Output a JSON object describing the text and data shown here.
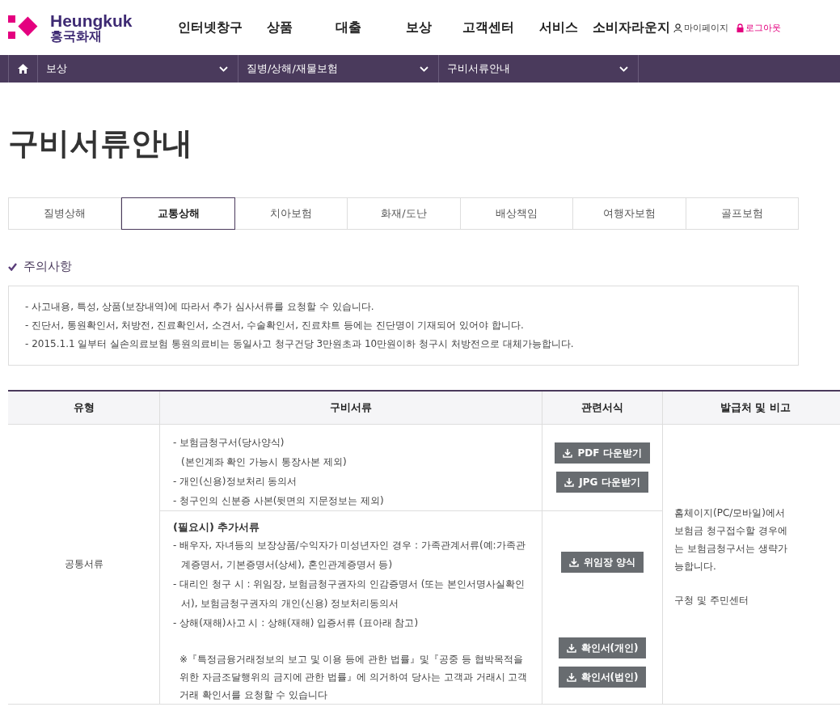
{
  "logo": {
    "name": "Heungkuk",
    "name_ko": "흥국화재"
  },
  "nav": [
    "인터넷창구",
    "상품",
    "대출",
    "보상",
    "고객센터",
    "서비스",
    "소비자라운지"
  ],
  "user_links": [
    {
      "kind": "user",
      "label": "마이페이지"
    },
    {
      "kind": "lock",
      "label": "로그아웃"
    }
  ],
  "breadcrumb": [
    "보상",
    "질병/상해/재물보험",
    "구비서류안내"
  ],
  "page_title": "구비서류안내",
  "tabs": [
    {
      "label": "질병상해",
      "selected": false
    },
    {
      "label": "교통상해",
      "selected": true
    },
    {
      "label": "치아보험",
      "selected": false
    },
    {
      "label": "화재/도난",
      "selected": false
    },
    {
      "label": "배상책임",
      "selected": false
    },
    {
      "label": "여행자보험",
      "selected": false
    },
    {
      "label": "골프보험",
      "selected": false
    }
  ],
  "notice": {
    "title": "주의사항",
    "items": [
      "- 사고내용, 특성, 상품(보장내역)에 따라서 추가 심사서류를 요청할 수 있습니다.",
      "- 진단서, 통원확인서, 처방전, 진료확인서, 소견서, 수술확인서, 진료챠트 등에는 진단명이 기재되어 있어야 합니다.",
      "- 2015.1.1 일부터 실손의료보험 통원의료비는 동일사고 청구건당 3만원초과 10만원이하 청구시 처방전으로 대체가능합니다."
    ]
  },
  "table": {
    "columns": [
      "유형",
      "구비서류",
      "관련서식",
      "발급처 및 비고"
    ],
    "category": "공통서류",
    "remarks": [
      "홈체이지(PC/모바일)에서 보험금 청구접수할 경우에는 보험금청구서는 생략가능합니다.",
      "구청 및 주민센터"
    ],
    "rows": [
      {
        "items": [
          "- 보험금청구서(당사양식)",
          "(본인계좌 확인 가능시 통장사본 제외)",
          "- 개인(신용)정보처리 동의서",
          "- 청구인의 신분증 사본(뒷면의 지문정보는 제외)"
        ],
        "button_groups": [
          [
            "PDF 다운받기",
            "JPG 다운받기"
          ]
        ]
      },
      {
        "heading": "(필요시) 추가서류",
        "items": [
          "- 배우자, 자녀등의 보장상품/수익자가 미성년자인 경우 : 가족관계서류(예:가족관계증명서, 기본증명서(상세), 혼인관계증명서 등)",
          "- 대리인 청구 시 : 위임장, 보험금청구권자의 인감증명서 (또는 본인서명사실확인서), 보험금청구권자의 개인(신용) 정보처리동의서",
          "- 상해(재해)사고 시 : 상해(재해) 입증서류 (표아래 참고)"
        ],
        "footnote": "※『특정금융거래정보의 보고 및 이용 등에 관한 법률』및『공중 등 협박목적을 위한 자금조달행위의 금지에 관한 법률』에 의거하여 당사는 고객과 거래시 고객 거래 확인서를 요청할 수 있습니다",
        "button_groups": [
          [
            "위임장 양식"
          ],
          [
            "확인서(개인)",
            "확인서(법인)"
          ]
        ]
      }
    ]
  }
}
